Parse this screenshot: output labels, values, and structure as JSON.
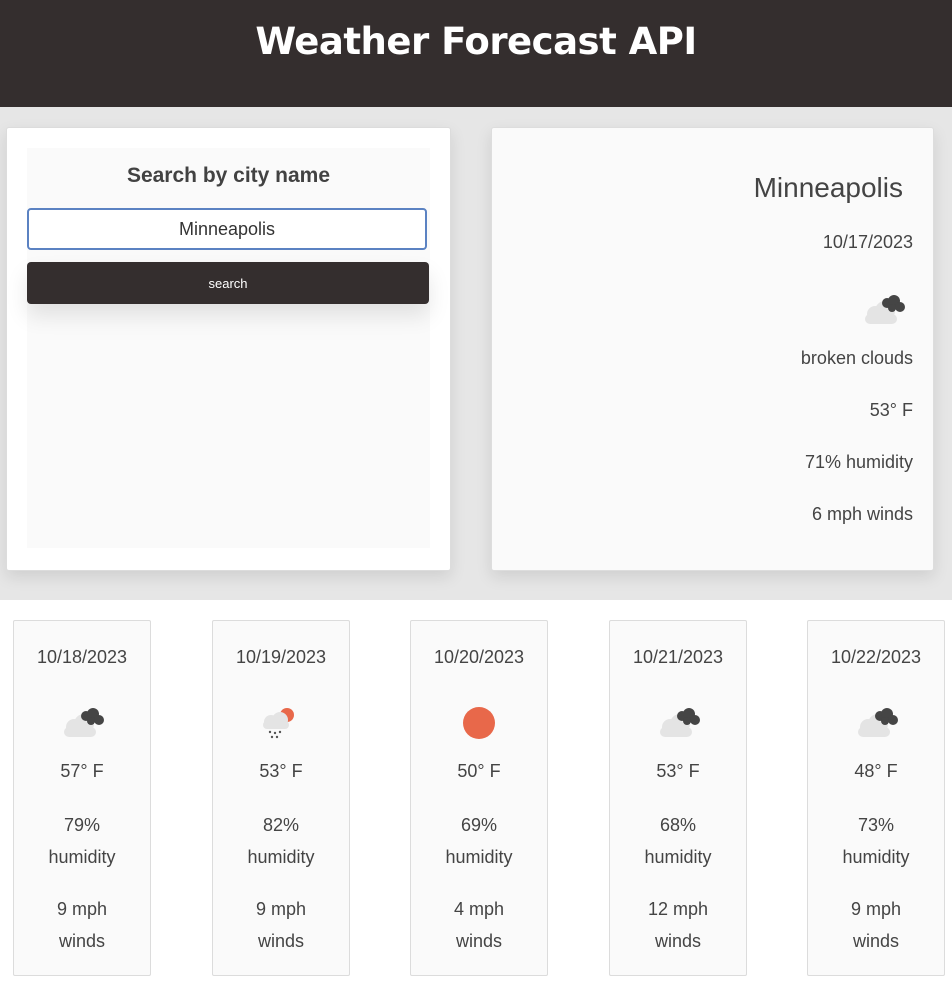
{
  "header": {
    "title": "Weather Forecast API"
  },
  "search": {
    "title": "Search by city name",
    "input_value": "Minneapolis",
    "button_label": "search"
  },
  "current": {
    "city": "Minneapolis",
    "date": "10/17/2023",
    "icon": "broken-clouds-icon",
    "description": "broken clouds",
    "temp": "53° F",
    "humidity": "71% humidity",
    "wind": "6 mph winds"
  },
  "forecast": [
    {
      "date": "10/18/2023",
      "icon": "broken-clouds-icon",
      "temp": "57° F",
      "humidity_value": "79%",
      "humidity_label": "humidity",
      "wind_value": "9 mph",
      "wind_label": "winds"
    },
    {
      "date": "10/19/2023",
      "icon": "rain-sun-icon",
      "temp": "53° F",
      "humidity_value": "82%",
      "humidity_label": "humidity",
      "wind_value": "9 mph",
      "wind_label": "winds"
    },
    {
      "date": "10/20/2023",
      "icon": "sun-icon",
      "temp": "50° F",
      "humidity_value": "69%",
      "humidity_label": "humidity",
      "wind_value": "4 mph",
      "wind_label": "winds"
    },
    {
      "date": "10/21/2023",
      "icon": "broken-clouds-icon",
      "temp": "53° F",
      "humidity_value": "68%",
      "humidity_label": "humidity",
      "wind_value": "12 mph",
      "wind_label": "winds"
    },
    {
      "date": "10/22/2023",
      "icon": "broken-clouds-icon",
      "temp": "48° F",
      "humidity_value": "73%",
      "humidity_label": "humidity",
      "wind_value": "9 mph",
      "wind_label": "winds"
    }
  ],
  "colors": {
    "header_bg": "#342e2e",
    "sun": "#e8684a",
    "dark_cloud": "#454545",
    "light_cloud": "#e4e4e4",
    "input_border": "#5b82c2"
  }
}
